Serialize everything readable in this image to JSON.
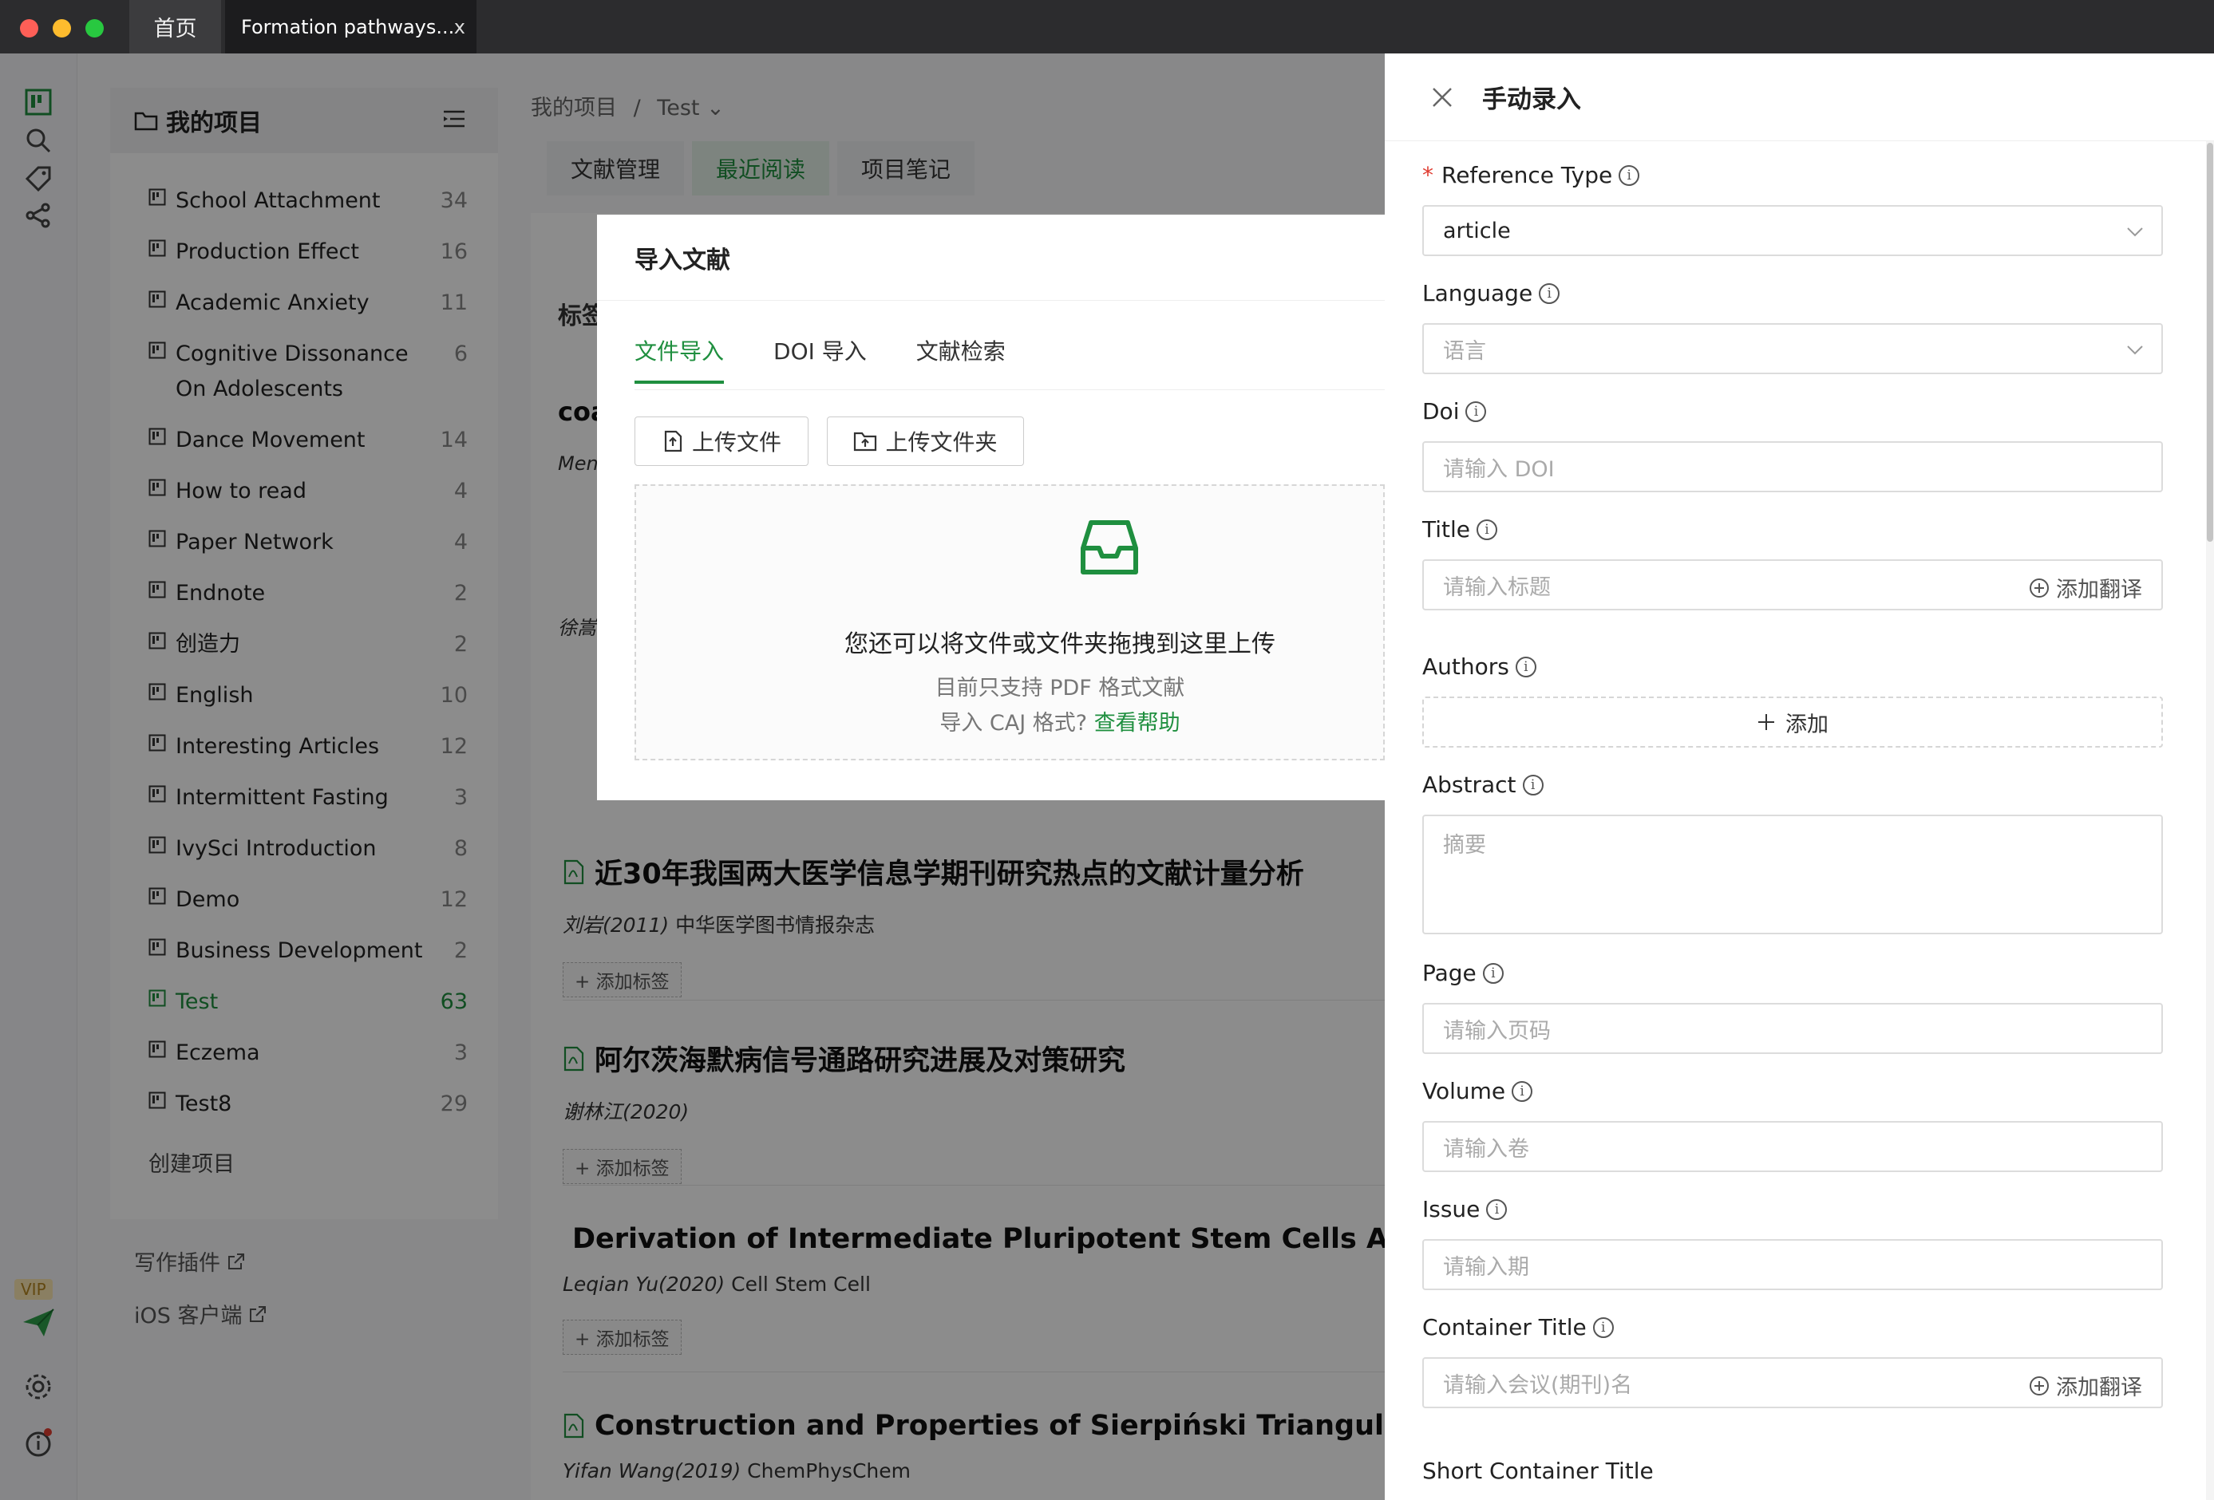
{
  "window": {
    "tab_home": "首页",
    "tab_active": "Formation pathways...",
    "tab_close": "x"
  },
  "sidebar": {
    "title": "我的项目",
    "projects": [
      {
        "name": "School Attachment",
        "count": "34"
      },
      {
        "name": "Production Effect",
        "count": "16"
      },
      {
        "name": "Academic Anxiety",
        "count": "11"
      },
      {
        "name": "Cognitive Dissonance On Adolescents",
        "count": "6"
      },
      {
        "name": "Dance Movement",
        "count": "14"
      },
      {
        "name": "How to read",
        "count": "4"
      },
      {
        "name": "Paper Network",
        "count": "4"
      },
      {
        "name": "Endnote",
        "count": "2"
      },
      {
        "name": "创造力",
        "count": "2"
      },
      {
        "name": "English",
        "count": "10"
      },
      {
        "name": "Interesting Articles",
        "count": "12"
      },
      {
        "name": "Intermittent Fasting",
        "count": "3"
      },
      {
        "name": "IvySci Introduction",
        "count": "8"
      },
      {
        "name": "Demo",
        "count": "12"
      },
      {
        "name": "Business Development",
        "count": "2"
      },
      {
        "name": "Test",
        "count": "63"
      },
      {
        "name": "Eczema",
        "count": "3"
      },
      {
        "name": "Test8",
        "count": "29"
      }
    ],
    "create_label": "创建项目",
    "writing_plugin": "写作插件",
    "ios_client": "iOS 客户端",
    "vip_label": "VIP"
  },
  "main": {
    "breadcrumb_root": "我的项目",
    "breadcrumb_sep": "/",
    "breadcrumb_current": "Test",
    "tabs": [
      "文献管理",
      "最近阅读",
      "项目笔记"
    ],
    "tag_label_partial": "标签",
    "partial_title": "coa",
    "partial_author": "Men",
    "partial_author2": "徐嵩",
    "articles": [
      {
        "title": "近30年我国两大医学信息学期刊研究热点的文献计量分析",
        "author": "刘岩(2011)",
        "journal": "中华医学图书情报杂志",
        "tag": "+ 添加标签"
      },
      {
        "title": "阿尔茨海默病信号通路研究进展及对策研究",
        "author": "谢林江(2020)",
        "journal": "",
        "tag": "+ 添加标签"
      },
      {
        "title": "Derivation of Intermediate Pluripotent Stem Cells Amenable to Primordial Germ Cell Specification",
        "author": "Leqian Yu(2020)",
        "journal": "Cell Stem Cell",
        "tag": "+ 添加标签"
      },
      {
        "title": "Construction and Properties of Sierpiński Triangular Fractals",
        "author": "Yifan Wang(2019)",
        "journal": "ChemPhysChem",
        "tag": ""
      }
    ]
  },
  "import_dialog": {
    "title": "导入文献",
    "tabs": [
      "文件导入",
      "DOI 导入",
      "文献检索"
    ],
    "upload_file": "上传文件",
    "upload_folder": "上传文件夹",
    "drop_main": "您还可以将文件或文件夹拖拽到这里上传",
    "drop_sub1": "目前只支持 PDF 格式文献",
    "drop_sub2": "导入 CAJ 格式?",
    "help_link": "查看帮助"
  },
  "manual_entry": {
    "title": "手动录入",
    "required_mark": "*",
    "reference_type_label": "Reference Type",
    "reference_type_value": "article",
    "language_label": "Language",
    "language_placeholder": "语言",
    "doi_label": "Doi",
    "doi_placeholder": "请输入 DOI",
    "title_label": "Title",
    "title_placeholder": "请输入标题",
    "add_translation": "添加翻译",
    "authors_label": "Authors",
    "authors_add": "添加",
    "abstract_label": "Abstract",
    "abstract_placeholder": "摘要",
    "page_label": "Page",
    "page_placeholder": "请输入页码",
    "volume_label": "Volume",
    "volume_placeholder": "请输入卷",
    "issue_label": "Issue",
    "issue_placeholder": "请输入期",
    "container_title_label": "Container Title",
    "container_title_placeholder": "请输入会议(期刊)名",
    "short_container_title_label": "Short Container Title"
  },
  "colors": {
    "accent_green": "#1f8f3f",
    "required_red": "#e03c31"
  }
}
